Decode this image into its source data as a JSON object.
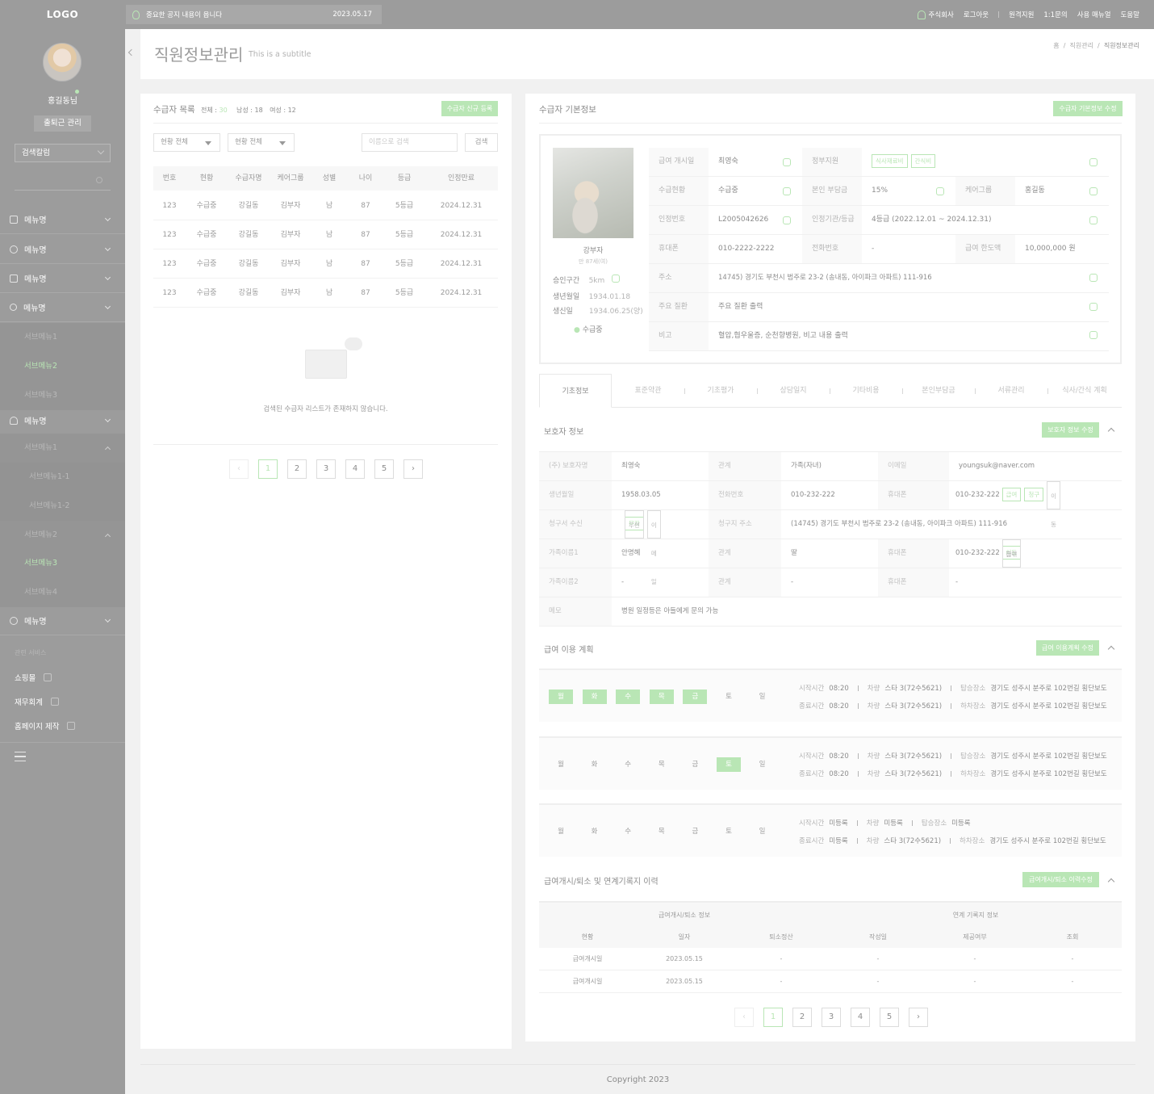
{
  "topbar": {
    "logo": "LOGO",
    "notice": "중요한 공지 내용이 옵니다",
    "notice_date": "2023.05.17",
    "menu": [
      "주식회사",
      "로그아웃",
      "원격지원",
      "1:1문의",
      "사용 매뉴얼",
      "도움말"
    ]
  },
  "sidebar": {
    "user": "홍길동님",
    "attend_btn": "출퇴근 관리",
    "select": "검색칼럼",
    "menus": [
      "메뉴명",
      "메뉴명",
      "메뉴명",
      "메뉴명",
      "메뉴명",
      "메뉴명"
    ],
    "subs": [
      "서브메뉴1",
      "서브메뉴2",
      "서브메뉴3"
    ],
    "subs2": [
      "서브메뉴1",
      "서브메뉴1-1",
      "서브메뉴1-2",
      "서브메뉴2",
      "서브메뉴3",
      "서브메뉴4"
    ],
    "related_label": "관련 서비스",
    "related": [
      "쇼핑몰",
      "재무회계",
      "홈페이지 제작"
    ]
  },
  "header": {
    "title": "직원정보관리",
    "subtitle": "This is a subtitle",
    "bread": [
      "홈",
      "직원관리",
      "직원정보관리"
    ]
  },
  "list": {
    "title": "수급자 목록",
    "total_label": "전체 :",
    "total": "30",
    "male": "남성 : 18",
    "female": "여성 : 12",
    "new_btn": "수급자 신규 등록",
    "filter1": "현황 전체",
    "filter2": "현황 전체",
    "search_ph": "이름으로 검색",
    "search_btn": "검색",
    "cols": [
      "번호",
      "현황",
      "수급자명",
      "케어그룹",
      "성별",
      "나이",
      "등급",
      "인정만료"
    ],
    "rows": [
      [
        "123",
        "수급중",
        "강길동",
        "김부자",
        "남",
        "87",
        "5등급",
        "2024.12.31"
      ],
      [
        "123",
        "수급중",
        "강길동",
        "김부자",
        "남",
        "87",
        "5등급",
        "2024.12.31"
      ],
      [
        "123",
        "수급중",
        "강길동",
        "김부자",
        "남",
        "87",
        "5등급",
        "2024.12.31"
      ],
      [
        "123",
        "수급중",
        "강길동",
        "김부자",
        "남",
        "87",
        "5등급",
        "2024.12.31"
      ]
    ],
    "empty": "검색된 수급자 리스트가 존재하지 않습니다.",
    "pages": [
      "‹",
      "1",
      "2",
      "3",
      "4",
      "5",
      "›"
    ]
  },
  "basic": {
    "title": "수급자 기본정보",
    "edit_btn": "수급자 기본정보 수정",
    "name": "강부자",
    "age": "만 87세(여)",
    "approve_l": "승인구간",
    "approve_v": "5km",
    "birth_l": "생년월일",
    "birth_v": "1934.01.18",
    "born_l": "생신일",
    "born_v": "1934.06.25(양)",
    "status": "수급중",
    "f": {
      "start_l": "급여 개시일",
      "start_v": "최영숙",
      "gov_l": "정부지원",
      "tag1": "식사재료비",
      "tag2": "간식비",
      "cur_l": "수급현황",
      "cur_v": "수급중",
      "self_l": "본인 부담금",
      "self_v": "15%",
      "care_l": "케어그룹",
      "care_v": "홍길동",
      "cert_l": "인정번호",
      "cert_v": "L2005042626",
      "org_l": "인정기관/등급",
      "org_v": "4등급 (2022.12.01 ~ 2024.12.31)",
      "mobile_l": "휴대폰",
      "mobile_v": "010-2222-2222",
      "tel_l": "전화번호",
      "tel_v": "-",
      "limit_l": "급여 한도액",
      "limit_v": "10,000,000 원",
      "addr_l": "주소",
      "addr_v": "14745) 경기도 부천시 범주로 23-2 (송내동, 아이파크 아파트) 111-916",
      "dis_l": "주요 질환",
      "dis_v": "주요 질환 출력",
      "memo_l": "비고",
      "memo_v": "혈압,협우울증, 순천향병원, 비고 내용 출력"
    }
  },
  "tabs": [
    "기초정보",
    "표준약관",
    "기초평가",
    "상담일지",
    "기타비용",
    "본인부담금",
    "서류관리",
    "식사/간식 계획"
  ],
  "guardian": {
    "title": "보호자 정보",
    "btn": "보호자 정보 수정",
    "r1": [
      "(주) 보호자명",
      "최영숙",
      "관계",
      "가족(자녀)",
      "이메일",
      "youngsuk@naver.com"
    ],
    "r2": [
      "생년월일",
      "1958.03.05",
      "전화번호",
      "010-232-222",
      "휴대폰",
      "010-232-222"
    ],
    "r2tags": [
      "급여",
      "청구",
      "이동"
    ],
    "r3": [
      "청구서 수신",
      "청구지 주소",
      "(14745) 경기도 부천시 범주로 23-2 (송내동, 아이파크 아파트) 111-916"
    ],
    "r3tags": [
      "우편",
      "문자",
      "이메일"
    ],
    "r4": [
      "가족이름1",
      "안명혜",
      "관계",
      "딸",
      "휴대폰",
      "010-232-222"
    ],
    "r4tags": [
      "급여",
      "청구",
      "이동"
    ],
    "r5": [
      "가족이름2",
      "-",
      "관계",
      "-",
      "휴대폰",
      "-"
    ],
    "r6": [
      "메모",
      "병원 일정등은 아들에게 문의 가능"
    ]
  },
  "plan": {
    "title": "급여 이용 계획",
    "btn": "급여 이용계획 수정",
    "days": [
      "월",
      "화",
      "수",
      "목",
      "금",
      "토",
      "일"
    ],
    "rows": [
      {
        "on": [
          1,
          1,
          1,
          1,
          1,
          0,
          0
        ],
        "st": "08:20",
        "car1": "스타 3(72수5621)",
        "pick": "경기도 성주시 분주로 102번길 횡단보도",
        "et": "08:20",
        "car2": "스타 3(72수5621)",
        "drop": "경기도 성주시 분주로 102번길 횡단보도"
      },
      {
        "on": [
          0,
          0,
          0,
          0,
          0,
          1,
          0
        ],
        "st": "08:20",
        "car1": "스타 3(72수5621)",
        "pick": "경기도 성주시 분주로 102번길 횡단보도",
        "et": "08:20",
        "car2": "스타 3(72수5621)",
        "drop": "경기도 성주시 분주로 102번길 횡단보도"
      },
      {
        "on": [
          0,
          0,
          0,
          0,
          0,
          0,
          0
        ],
        "st": "미등록",
        "car1": "미등록",
        "pick": "미등록",
        "et": "미등록",
        "car2": "스타 3(72수5621)",
        "drop": "경기도 성주시 분주로 102번길 횡단보도"
      }
    ],
    "labels": {
      "start": "시작시간",
      "end": "종료시간",
      "car": "차량",
      "pick": "탑승장소",
      "drop": "하차장소"
    }
  },
  "history": {
    "title": "급여개시/퇴소 및 연계기록지 이력",
    "btn": "급여개시/퇴소 이력수정",
    "g1": "급여개시/퇴소 정보",
    "g2": "연계 기록지 정보",
    "cols": [
      "현황",
      "일자",
      "퇴소정산",
      "작성일",
      "제공여부",
      "조회"
    ],
    "rows": [
      [
        "급여개시일",
        "2023.05.15",
        "-",
        "-",
        "-",
        "-"
      ],
      [
        "급여개시일",
        "2023.05.15",
        "-",
        "-",
        "-",
        "-"
      ]
    ],
    "pages": [
      "‹",
      "1",
      "2",
      "3",
      "4",
      "5",
      "›"
    ]
  },
  "footer": {
    "copy": "Copyright 2023"
  },
  "colors": {
    "accent": "#b9e6b5",
    "sidebar": "#9c9c9c"
  }
}
